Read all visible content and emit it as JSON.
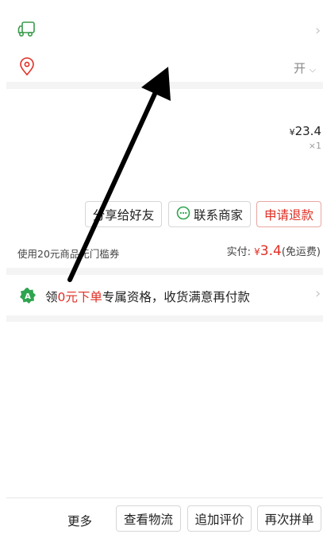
{
  "shipping": {
    "icon": "truck-icon",
    "chevron": "›"
  },
  "address": {
    "icon": "location-pin-icon",
    "expand_text": "开",
    "expand_chevron": "⌵"
  },
  "product": {
    "price_symbol": "¥",
    "price": "23.4",
    "quantity": "×1"
  },
  "actions": {
    "share": "分享给好友",
    "contact": "联系商家",
    "refund": "申请退款"
  },
  "payment": {
    "coupon": "使用20元商品无门槛券",
    "paid_label": "实付: ",
    "paid_symbol": "¥",
    "paid_amount": "3.4",
    "shipping_note": "(免运费)"
  },
  "promo": {
    "prefix": "领",
    "highlight": "0元下单",
    "suffix": "专属资格，收货满意再付款",
    "chevron": "›"
  },
  "footer": {
    "more": "更多",
    "logistics": "查看物流",
    "add_review": "追加评价",
    "reorder": "再次拼单"
  },
  "colors": {
    "accent": "#e02e24",
    "green": "#2fa44f",
    "divider": "#f4f4f4"
  }
}
